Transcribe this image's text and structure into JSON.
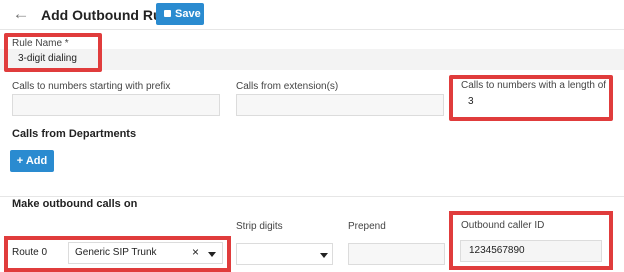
{
  "header": {
    "title": "Add Outbound Rule",
    "save_label": "Save"
  },
  "form": {
    "rule_name": {
      "label": "Rule Name *",
      "value": "3-digit dialing"
    },
    "prefix": {
      "label": "Calls to numbers starting with prefix",
      "value": ""
    },
    "extensions": {
      "label": "Calls from extension(s)",
      "value": ""
    },
    "length": {
      "label": "Calls to numbers with a length of",
      "value": "3"
    },
    "departments": {
      "title": "Calls from Departments",
      "add_label": "Add"
    },
    "outbound": {
      "title": "Make outbound calls on",
      "strip_label": "Strip digits",
      "prepend_label": "Prepend",
      "caller_id_label": "Outbound caller ID",
      "route_label": "Route 0",
      "trunk_value": "Generic SIP Trunk",
      "caller_id_value": "1234567890"
    }
  },
  "colors": {
    "accent": "#2a8bd0",
    "highlight": "#e03c3c"
  }
}
